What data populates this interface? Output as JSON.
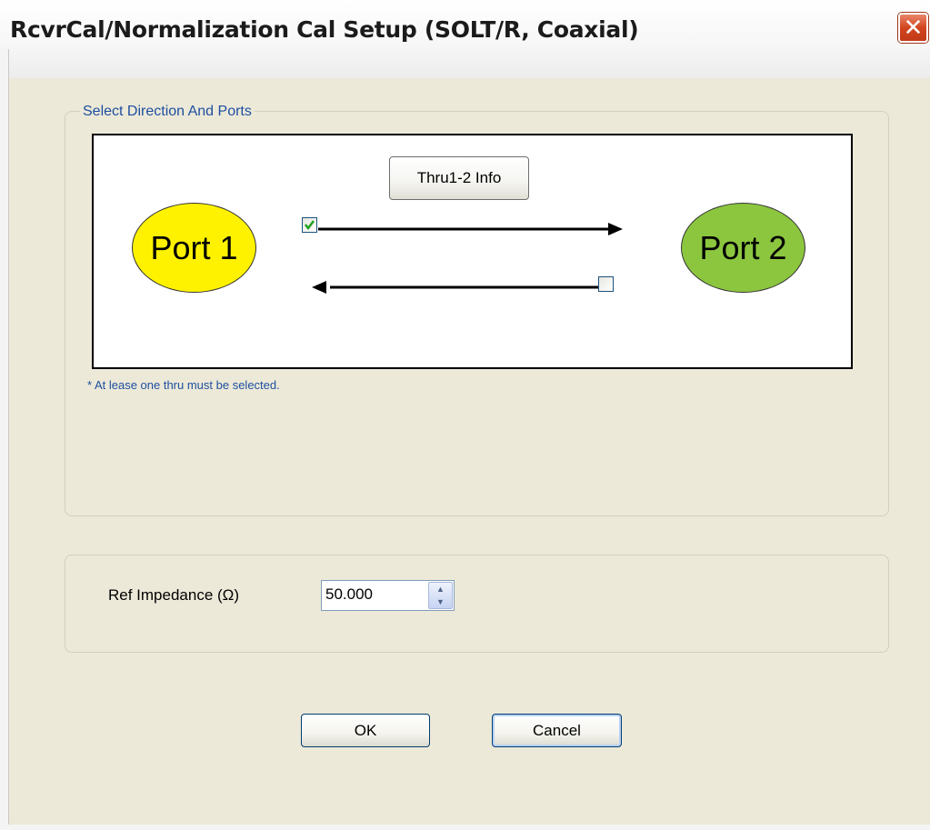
{
  "window": {
    "title": "RcvrCal/Normalization Cal Setup (SOLT/R, Coaxial)",
    "close_glyph": "✕"
  },
  "direction_group": {
    "legend": "Select Direction And Ports",
    "info_button_label": "Thru1-2 Info",
    "port1_label": "Port 1",
    "port2_label": "Port 2",
    "port1_color": "#fff200",
    "port2_color": "#8cc63f",
    "thru_1_to_2_checked": true,
    "thru_2_to_1_checked": false,
    "note": "* At lease one thru must be selected."
  },
  "impedance_group": {
    "label": "Ref Impedance (Ω)",
    "value": "50.000"
  },
  "buttons": {
    "ok_label": "OK",
    "cancel_label": "Cancel"
  },
  "icons": {
    "close": "close-icon",
    "check": "checkmark-icon",
    "spin_up": "spin-up-icon",
    "spin_down": "spin-down-icon"
  }
}
